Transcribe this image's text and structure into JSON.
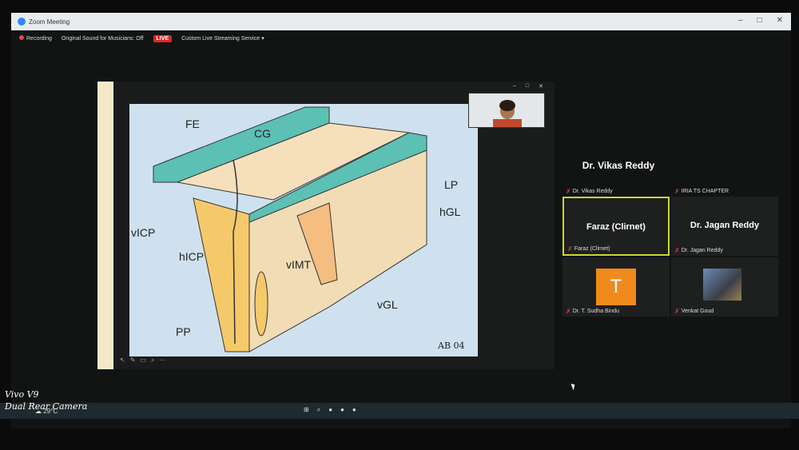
{
  "window": {
    "title": "Zoom Meeting",
    "controls": [
      "–",
      "□",
      "✕"
    ]
  },
  "toolbar": {
    "recording": "Recording",
    "original_sound": "Original Sound for Musicians: Off",
    "live_badge": "LIVE",
    "streaming": "Custom Live Streaming Service"
  },
  "slide": {
    "labels": [
      "FE",
      "CG",
      "LP",
      "hGL",
      "vICP",
      "hICP",
      "vIMT",
      "vGL",
      "PP"
    ],
    "signature": "AB 04"
  },
  "selfview": {
    "controls": [
      "–",
      "□",
      "✕"
    ]
  },
  "participants": {
    "featured_name": "Dr. Vikas Reddy",
    "tiles": [
      {
        "label": "Dr. Vikas Reddy"
      },
      {
        "label": "IRIA TS CHAPTER"
      },
      {
        "display": "Faraz (Clirnet)",
        "label": "Faraz (Clirnet)"
      },
      {
        "display": "Dr. Jagan Reddy",
        "label": "Dr. Jagan Reddy"
      },
      {
        "avatar": "T",
        "label": "Dr. T. Sudha Bindu"
      },
      {
        "label": "Venkat Goud"
      }
    ]
  },
  "taskbar": {
    "weather": "29°C"
  },
  "watermark": {
    "line1": "Vivo V9",
    "line2": "Dual Rear Camera"
  }
}
